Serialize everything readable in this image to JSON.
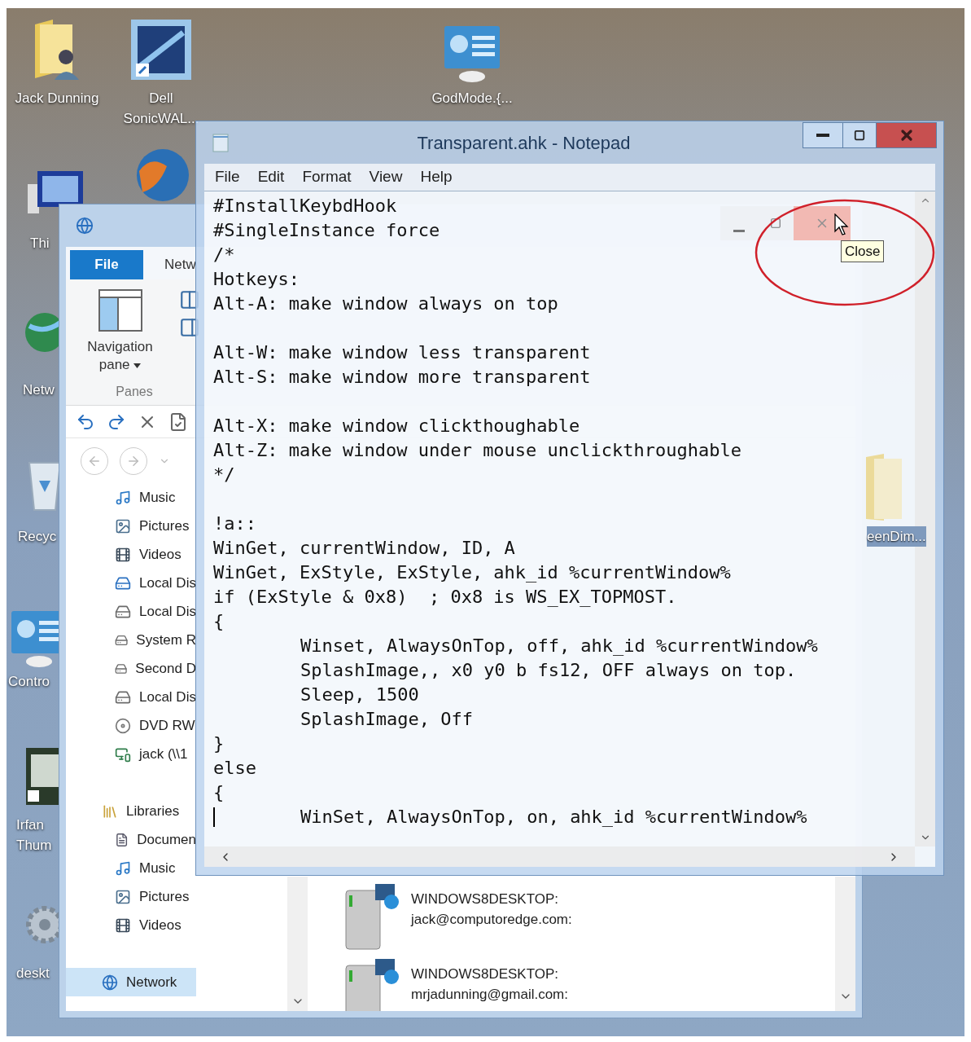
{
  "desktop_icons": [
    {
      "kind": "user-folder",
      "label": "Jack Dunning"
    },
    {
      "kind": "app-shortcut",
      "label": "Dell SonicWAL..."
    },
    {
      "kind": "control-panel",
      "label": "GodMode.{..."
    },
    {
      "kind": "computer",
      "label": "Thi"
    },
    {
      "kind": "browser"
    },
    {
      "kind": "network",
      "label": "Netw"
    },
    {
      "kind": "recycle-bin",
      "label": "Recyc"
    },
    {
      "kind": "control-panel",
      "label": "Contro"
    },
    {
      "kind": "photo-app",
      "label": "Irfan Thum"
    },
    {
      "kind": "settings-file",
      "label": "deskt"
    },
    {
      "kind": "folder",
      "label": "eenDim..."
    }
  ],
  "explorer": {
    "ribbon_tabs": [
      {
        "kind": "file",
        "label": "File"
      },
      {
        "kind": "tab",
        "label": "Netw"
      }
    ],
    "navigation_pane_button": "Navigation pane",
    "group_label": "Panes",
    "close_hovered": true,
    "nav_tree": [
      {
        "children": [
          {
            "kind": "music",
            "label": "Music",
            "selected": false
          },
          {
            "kind": "pictures",
            "label": "Pictures",
            "selected": false
          },
          {
            "kind": "videos",
            "label": "Videos",
            "selected": false
          },
          {
            "kind": "system-drive",
            "label": "Local Dis",
            "selected": false
          },
          {
            "kind": "drive",
            "label": "Local Dis",
            "selected": false
          },
          {
            "kind": "drive",
            "label": "System R",
            "selected": false
          },
          {
            "kind": "drive",
            "label": "Second D",
            "selected": false
          },
          {
            "kind": "drive",
            "label": "Local Dis",
            "selected": false
          },
          {
            "kind": "disc",
            "label": "DVD RW",
            "selected": false
          },
          {
            "kind": "network-drive",
            "label": "jack (\\\\1",
            "selected": false
          }
        ]
      },
      {
        "kind": "libraries",
        "label": "Libraries",
        "selected": false,
        "children": [
          {
            "kind": "document",
            "label": "Documen",
            "selected": false
          },
          {
            "kind": "music",
            "label": "Music",
            "selected": false
          },
          {
            "kind": "pictures",
            "label": "Pictures",
            "selected": false
          },
          {
            "kind": "videos",
            "label": "Videos",
            "selected": false
          }
        ]
      },
      {
        "kind": "network",
        "label": "Network",
        "selected": true
      }
    ],
    "media_devices": [
      {
        "name": "WINDOWS8DESKTOP:",
        "account": "jack@computoredge.com:"
      },
      {
        "name": "WINDOWS8DESKTOP:",
        "account": "mrjadunning@gmail.com:"
      }
    ],
    "tooltip": "Close"
  },
  "notepad": {
    "title": "Transparent.ahk - Notepad",
    "menu": [
      "File",
      "Edit",
      "Format",
      "View",
      "Help"
    ],
    "lines": [
      {
        "kind": "code",
        "text": "#InstallKeybdHook",
        "cursor": false
      },
      {
        "kind": "code",
        "text": "#SingleInstance force",
        "cursor": false
      },
      {
        "kind": "code",
        "text": "/*",
        "cursor": false
      },
      {
        "kind": "code",
        "text": "Hotkeys:",
        "cursor": false
      },
      {
        "kind": "code",
        "text": "Alt-A: make window always on top",
        "cursor": false
      },
      {
        "kind": "blank"
      },
      {
        "kind": "code",
        "text": "Alt-W: make window less transparent",
        "cursor": false
      },
      {
        "kind": "code",
        "text": "Alt-S: make window more transparent",
        "cursor": false
      },
      {
        "kind": "blank"
      },
      {
        "kind": "code",
        "text": "Alt-X: make window clickthoughable",
        "cursor": false
      },
      {
        "kind": "code",
        "text": "Alt-Z: make window under mouse unclickthroughable",
        "cursor": false
      },
      {
        "kind": "code",
        "text": "*/",
        "cursor": false
      },
      {
        "kind": "blank"
      },
      {
        "kind": "code",
        "text": "!a::",
        "cursor": false
      },
      {
        "kind": "code",
        "text": "WinGet, currentWindow, ID, A",
        "cursor": false
      },
      {
        "kind": "code",
        "text": "WinGet, ExStyle, ExStyle, ahk_id %currentWindow%",
        "cursor": false
      },
      {
        "kind": "code",
        "text": "if (ExStyle & 0x8)  ; 0x8 is WS_EX_TOPMOST.",
        "cursor": false
      },
      {
        "kind": "code",
        "text": "{",
        "cursor": false,
        "children": [
          {
            "kind": "code",
            "text": "Winset, AlwaysOnTop, off, ahk_id %currentWindow%",
            "cursor": false
          },
          {
            "kind": "code",
            "text": "SplashImage,, x0 y0 b fs12, OFF always on top.",
            "cursor": false
          },
          {
            "kind": "code",
            "text": "Sleep, 1500",
            "cursor": false
          },
          {
            "kind": "code",
            "text": "SplashImage, Off",
            "cursor": false
          }
        ]
      },
      {
        "kind": "code",
        "text": "}",
        "cursor": false
      },
      {
        "kind": "code",
        "text": "else",
        "cursor": false
      },
      {
        "kind": "code",
        "text": "{",
        "cursor": false,
        "children": [
          {
            "kind": "code",
            "text": "WinSet, AlwaysOnTop, on, ahk_id %currentWindow%",
            "cursor": true
          }
        ]
      }
    ]
  }
}
